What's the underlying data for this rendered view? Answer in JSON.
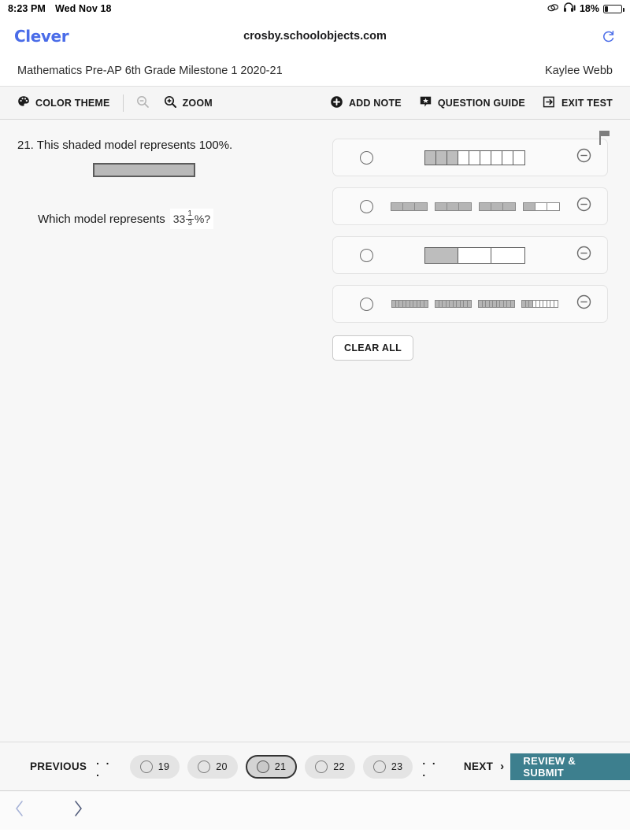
{
  "statusbar": {
    "time": "8:23 PM",
    "date": "Wed Nov 18",
    "battery_percent": "18%",
    "icons": [
      "screen-mirroring-icon",
      "headphones-icon",
      "battery-icon"
    ]
  },
  "browser": {
    "logo": "Clever",
    "url": "crosby.schoolobjects.com",
    "reload_icon": "reload-icon",
    "back_icon": "chevron-left-icon",
    "forward_icon": "chevron-right-icon"
  },
  "test_header": {
    "title": "Mathematics Pre-AP 6th Grade Milestone 1 2020-21",
    "student": "Kaylee Webb"
  },
  "toolbar": {
    "color_theme": "COLOR THEME",
    "zoom_out_icon": "zoom-out-icon",
    "zoom": "ZOOM",
    "add_note": "ADD NOTE",
    "question_guide": "QUESTION GUIDE",
    "exit_test": "EXIT TEST"
  },
  "question": {
    "flag_icon": "flag-icon",
    "number": "21.",
    "stem": "21. This shaded model represents 100%.",
    "prompt_prefix": "Which model represents",
    "value_whole": "33",
    "value_numerator": "1",
    "value_denominator": "3",
    "value_suffix": "%?",
    "whole_model": {
      "cells": 1,
      "shaded": 1
    },
    "clear_all": "CLEAR ALL",
    "options": [
      {
        "id": "option-a",
        "style": "single-bar",
        "cells": 9,
        "shaded": 3,
        "selected": false,
        "eliminate_icon": "minus-circle-icon"
      },
      {
        "id": "option-b",
        "style": "grouped",
        "groups": 4,
        "cells_per_group": 3,
        "shaded_per_group": [
          3,
          3,
          3,
          1
        ],
        "selected": false,
        "eliminate_icon": "minus-circle-icon"
      },
      {
        "id": "option-c",
        "style": "single-bar",
        "cells": 3,
        "shaded": 1,
        "selected": false,
        "eliminate_icon": "minus-circle-icon"
      },
      {
        "id": "option-d",
        "style": "grouped",
        "groups": 4,
        "cells_per_group": 10,
        "shaded_per_group": [
          10,
          10,
          10,
          3
        ],
        "selected": false,
        "eliminate_icon": "minus-circle-icon"
      }
    ]
  },
  "bottomnav": {
    "previous": "PREVIOUS",
    "dots_left": ". . .",
    "dots_right": ". . .",
    "next": "NEXT",
    "next_chevron": "›",
    "review_submit": "REVIEW & SUBMIT",
    "pages": [
      {
        "num": "19",
        "current": false
      },
      {
        "num": "20",
        "current": false
      },
      {
        "num": "21",
        "current": true
      },
      {
        "num": "22",
        "current": false
      },
      {
        "num": "23",
        "current": false
      }
    ]
  },
  "colors": {
    "clever_blue": "#4a6ce8",
    "review_teal": "#3d7f8e",
    "shade_gray": "#bdbdbd",
    "toolbar_bg": "#f5f5f5",
    "content_bg": "#f7f7f7"
  }
}
